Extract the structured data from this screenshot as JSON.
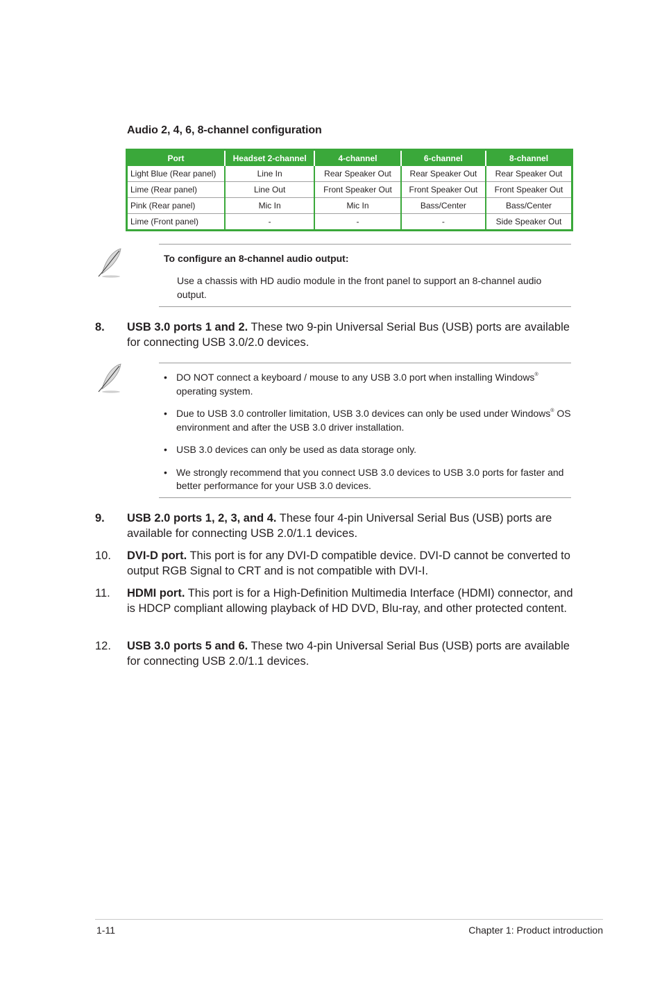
{
  "section_title": "Audio 2, 4, 6, 8-channel configuration",
  "audio_table": {
    "headers": [
      "Port",
      "Headset 2-channel",
      "4-channel",
      "6-channel",
      "8-channel"
    ],
    "rows": [
      [
        "Light Blue (Rear panel)",
        "Line In",
        "Rear Speaker Out",
        "Rear Speaker Out",
        "Rear Speaker Out"
      ],
      [
        "Lime (Rear panel)",
        "Line Out",
        "Front Speaker Out",
        "Front Speaker Out",
        "Front Speaker Out"
      ],
      [
        "Pink (Rear panel)",
        "Mic In",
        "Mic In",
        "Bass/Center",
        "Bass/Center"
      ],
      [
        "Lime (Front panel)",
        "-",
        "-",
        "-",
        "Side Speaker Out"
      ]
    ],
    "accent_color": "#3aa83a"
  },
  "note1": {
    "icon": "feather-quill-icon",
    "heading": "To configure an 8-channel audio output:",
    "body": "Use a chassis with HD audio module in the front panel to support an 8-channel audio output."
  },
  "items": [
    {
      "num": "8.",
      "title": "USB 3.0 ports 1 and 2.",
      "text": " These two 9-pin Universal Serial Bus (USB) ports are available for connecting USB 3.0/2.0 devices."
    },
    {
      "num": "9.",
      "title": "USB 2.0 ports 1, 2, 3, and 4.",
      "text": " These four 4-pin Universal Serial Bus (USB) ports are available for connecting USB 2.0/1.1 devices."
    },
    {
      "num": "10.",
      "title": "DVI-D port.",
      "text": " This port is for any DVI-D compatible device. DVI-D cannot be converted to output RGB Signal to CRT and is not compatible with DVI-I."
    },
    {
      "num": "11.",
      "title": "HDMI port.",
      "text": " This port is for a High-Definition Multimedia Interface (HDMI) connector, and is HDCP compliant allowing playback of HD DVD, Blu-ray, and other protected content."
    },
    {
      "num": "12.",
      "title": "USB 3.0 ports 5 and 6.",
      "text": " These two 4-pin Universal Serial Bus (USB) ports are available for connecting USB 2.0/1.1 devices."
    }
  ],
  "note2": {
    "icon": "feather-quill-icon",
    "bullet": "•",
    "bullets": [
      {
        "before": "DO NOT connect a keyboard / mouse to any USB 3.0 port when installing Windows",
        "sup": "®",
        "after": " operating system."
      },
      {
        "before": "Due to USB 3.0 controller limitation, USB 3.0 devices can only be used under Windows",
        "sup": "®",
        "after": " OS environment and after the USB 3.0 driver installation."
      },
      {
        "before": "USB 3.0 devices can only be used as data storage only.",
        "sup": "",
        "after": ""
      },
      {
        "before": "We strongly recommend that you connect USB 3.0 devices to USB 3.0 ports for faster and better performance for your USB 3.0 devices.",
        "sup": "",
        "after": ""
      }
    ]
  },
  "footer": {
    "page_number": "1-11",
    "chapter": "Chapter 1: Product introduction"
  }
}
